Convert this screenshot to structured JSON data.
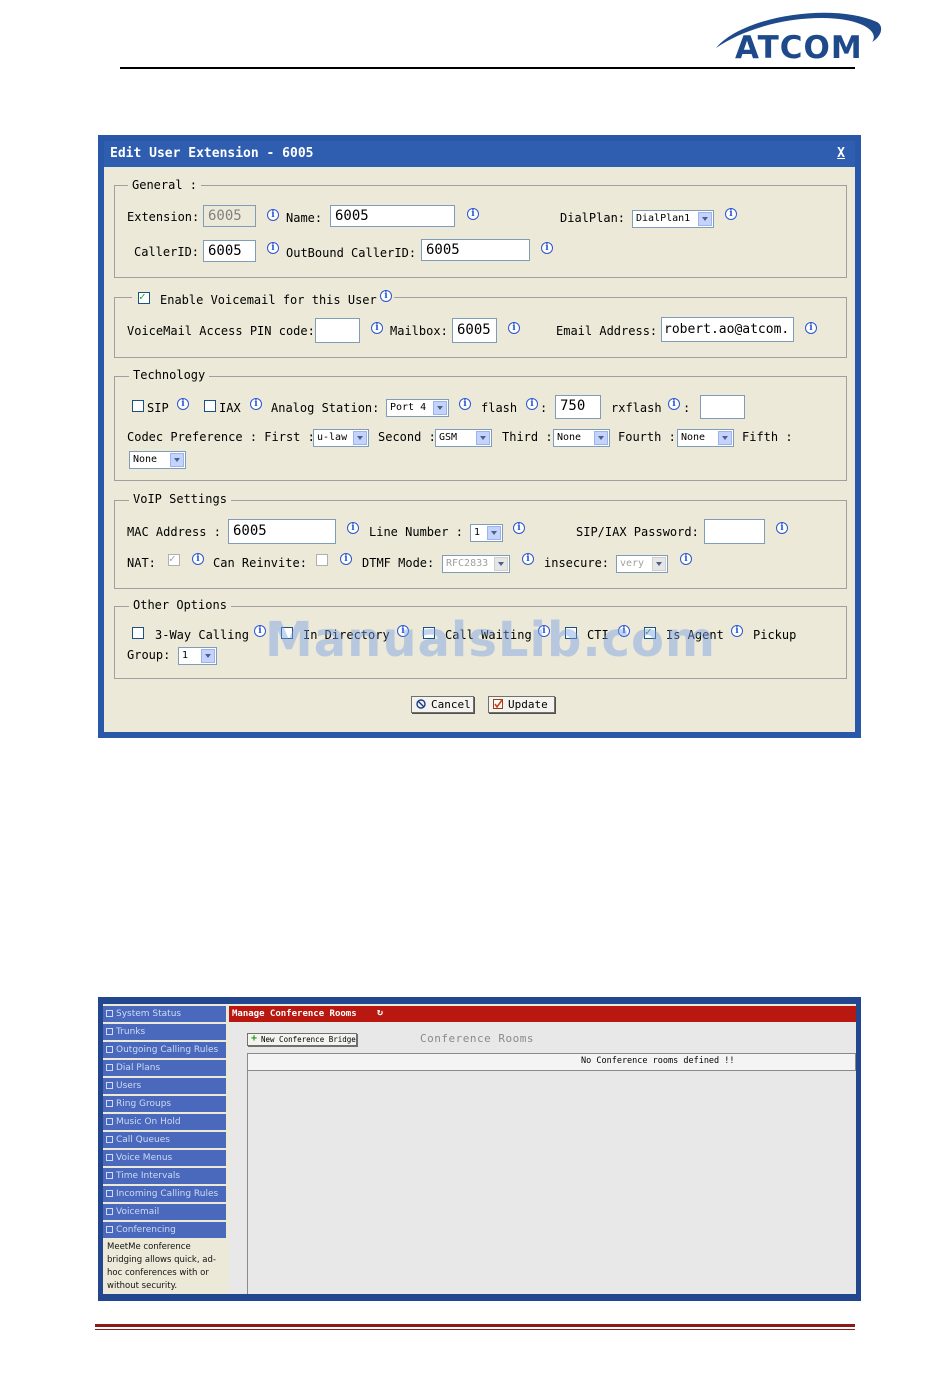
{
  "header": {
    "logo_text": "ATCOM",
    "logo_color": "#1e4a8c"
  },
  "dialog": {
    "title": "Edit User Extension - 6005",
    "close_label": "X",
    "general": {
      "legend": "General :",
      "extension_label": "Extension:",
      "extension_value": "6005",
      "name_label": "Name:",
      "name_value": "6005",
      "dialplan_label": "DialPlan:",
      "dialplan_value": "DialPlan1",
      "callerid_label": "CallerID:",
      "callerid_value": "6005",
      "outbound_label": "OutBound CallerID:",
      "outbound_value": "6005"
    },
    "voicemail": {
      "enable_label": "Enable Voicemail for this User",
      "enabled": true,
      "pin_label": "VoiceMail Access PIN code:",
      "pin_value": "",
      "mailbox_label": "Mailbox:",
      "mailbox_value": "6005",
      "email_label": "Email Address:",
      "email_value": "robert.ao@atcom."
    },
    "technology": {
      "legend": "Technology",
      "sip_label": "SIP",
      "iax_label": "IAX",
      "analog_label": "Analog Station:",
      "analog_value": "Port 4",
      "flash_label": "flash",
      "flash_colon": ":",
      "flash_value": "750",
      "rxflash_label": "rxflash",
      "rxflash_colon": ":",
      "rxflash_value": "",
      "codec_label": "Codec Preference : First :",
      "first_value": "u-law",
      "second_label": "Second :",
      "second_value": "GSM",
      "third_label": "Third :",
      "third_value": "None",
      "fourth_label": "Fourth :",
      "fourth_value": "None",
      "fifth_label": "Fifth :",
      "fifth_value": "None"
    },
    "voip": {
      "legend": "VoIP Settings",
      "mac_label": "MAC Address :",
      "mac_value": "6005",
      "line_label": "Line Number :",
      "line_value": "1",
      "password_label": "SIP/IAX Password:",
      "password_value": "",
      "nat_label": "NAT:",
      "reinvite_label": "Can Reinvite:",
      "dtmf_label": "DTMF Mode:",
      "dtmf_value": "RFC2833",
      "insecure_label": "insecure:",
      "insecure_value": "very"
    },
    "other": {
      "legend": "Other Options",
      "threeway_label": "3-Way Calling",
      "directory_label": "In Directory",
      "callwaiting_label": "Call Waiting",
      "cti_label": "CTI",
      "agent_label": "Is Agent",
      "pickup_label": "Pickup",
      "group_label": "Group:",
      "group_value": "1"
    },
    "cancel_label": "Cancel",
    "update_label": "Update"
  },
  "watermark": "ManualsLib.com",
  "conference": {
    "sidebar": [
      "System Status",
      "Trunks",
      "Outgoing Calling Rules",
      "Dial Plans",
      "Users",
      "Ring Groups",
      "Music On Hold",
      "Call Queues",
      "Voice Menus",
      "Time Intervals",
      "Incoming Calling Rules",
      "Voicemail",
      "Conferencing"
    ],
    "sidebar_desc": "MeetMe conference bridging allows quick, ad-hoc conferences with or without security.",
    "title": "Manage Conference Rooms",
    "new_button": "New Conference Bridge",
    "section_label": "Conference Rooms",
    "empty_message": "No Conference rooms defined !!"
  },
  "colors": {
    "dialog_frame": "#2a58a8",
    "dialog_bg": "#ece9d8",
    "conf_titlebar": "#b8180f",
    "sidebar": "#4a69bd"
  }
}
